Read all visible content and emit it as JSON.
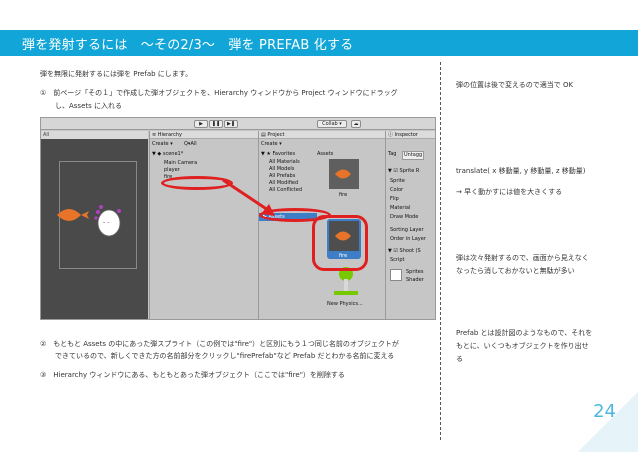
{
  "header": {
    "title": "弾を発射するには　〜その2/3〜　弾を PREFAB 化する"
  },
  "left": {
    "intro": "弾を無限に発射するには弾を Prefab にします。",
    "step1_line1": "①　前ページ「その１」で作成した弾オブジェクトを、Hierarchy ウィンドウから Project ウィンドウにドラッグ",
    "step1_line2": "し、Assets に入れる",
    "step2_line1": "②　もともと Assets の中にあった弾スプライト（この例では\"fire\"）と区別にもう１つ同じ名前のオブジェクトが",
    "step2_line2": "できているので、新しくできた方の名前部分をクリックし\"firePrefab\"など Prefab だとわかる名前に変える",
    "step3": "③　Hierarchy ウィンドウにある、もともとあった弾オブジェクト（ここでは\"fire\"）を削除する"
  },
  "right": {
    "note1": "弾の位置は後で変えるので適当で OK",
    "note2": "translate( x 移動量, y 移動量, z 移動量)",
    "note3": "→ 早く動かすには値を大きくする",
    "note4_line1": "弾は次々発射するので、画面から見えなく",
    "note4_line2": "なったら消しておかないと無駄が多い",
    "note5_line1": "Prefab とは設計図のようなもので、それを",
    "note5_line2": "もとに、いくつもオブジェクトを作り出せ",
    "note5_line3": "る"
  },
  "page_number": "24",
  "unity": {
    "collab": "Collab ▾",
    "hierarchy_title": "Hierarchy",
    "create": "Create ▾",
    "search_all": "Q▾All",
    "scene_name": "scene1*",
    "hier_items": [
      "Main Camera",
      "player",
      "fire"
    ],
    "project_title": "Project",
    "project_create": "Create ▾",
    "favorites": "Favorites",
    "assets_col": "Assets",
    "fav_items": [
      "All Materials",
      "All Models",
      "All Prefabs",
      "All Modified",
      "All Conflicted"
    ],
    "assets_tree": "Assets",
    "asset_fire": "fire",
    "asset_fire2": "fire",
    "asset_new_physics": "New Physics...",
    "inspector_title": "Inspector",
    "insp_tag": "Tag",
    "insp_tag_val": "Untagg",
    "insp_sprite_r": "Sprite R",
    "insp_rows": [
      "Sprite",
      "Color",
      "Flip",
      "Material",
      "Draw Mode",
      "Sorting Layer",
      "Order in Layer"
    ],
    "insp_shoot": "Shoot (S",
    "insp_script": "Script",
    "insp_sprites": "Sprites",
    "insp_shader": "Shader",
    "scene_all": "All",
    "colors": {
      "header": "#12a6d8",
      "red": "#e02020",
      "fire": "#e8742a",
      "select": "#3d7ec6",
      "ghost_heart": "#b040c0"
    }
  }
}
